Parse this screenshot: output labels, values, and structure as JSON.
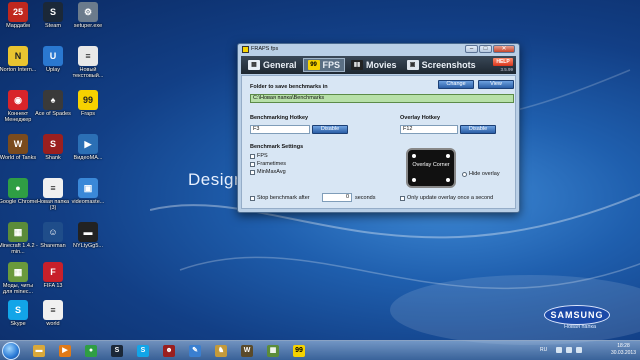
{
  "desktop": {
    "wallpaper_text": "Design",
    "brand": {
      "logo": "SAMSUNG",
      "subtitle": "Новая папка"
    },
    "icons": [
      {
        "label": "Мардабм",
        "color": "#c0281e",
        "glyph": "25"
      },
      {
        "label": "Steam",
        "color": "#1b2838",
        "glyph": "S"
      },
      {
        "label": "setuper.exe",
        "color": "#6b7b8c",
        "glyph": "⚙"
      },
      {
        "label": "Norton Intern...",
        "color": "#e9c430",
        "glyph": "N"
      },
      {
        "label": "Uplay",
        "color": "#2a78d0",
        "glyph": "U"
      },
      {
        "label": "Новый текстовый...",
        "color": "#e8e8e8",
        "glyph": "≡"
      },
      {
        "label": "Коннект Менеджер",
        "color": "#d8242a",
        "glyph": "◉"
      },
      {
        "label": "Ace of Spades",
        "color": "#3a3a3a",
        "glyph": "♠"
      },
      {
        "label": "Fraps",
        "color": "#f6d200",
        "glyph": "99"
      },
      {
        "label": "World of Tanks",
        "color": "#7a4b1e",
        "glyph": "W"
      },
      {
        "label": "Shank",
        "color": "#9a1f1f",
        "glyph": "S"
      },
      {
        "label": "ВидеоМА...",
        "color": "#2b6fb5",
        "glyph": "▶"
      },
      {
        "label": "Google Chrome",
        "color": "#2f9e44",
        "glyph": "●"
      },
      {
        "label": "Новая папка (3)",
        "color": "#f0f0f0",
        "glyph": "≡"
      },
      {
        "label": "videomaste...",
        "color": "#3a88d8",
        "glyph": "▣"
      },
      {
        "label": "Minecraft 1.4.2 - min...",
        "color": "#5b8c3a",
        "glyph": "▦"
      },
      {
        "label": "Shareman",
        "color": "#1f4d8a",
        "glyph": "☺"
      },
      {
        "label": "NYLtyGg5...",
        "color": "#222222",
        "glyph": "▬"
      },
      {
        "label": "Моды, читы для minec...",
        "color": "#6a9a3c",
        "glyph": "▦"
      },
      {
        "label": "FIFA 13",
        "color": "#c8202a",
        "glyph": "F"
      },
      {
        "label": "Skype",
        "color": "#12a5e8",
        "glyph": "S"
      },
      {
        "label": "world",
        "color": "#f0f0f0",
        "glyph": "≡"
      }
    ]
  },
  "window": {
    "title": "FRAPS fps",
    "controls": {
      "minimize": "–",
      "maximize": "□",
      "close": "✕"
    },
    "tabs": [
      {
        "label": "General",
        "icon": "grid-icon",
        "glyph": "▦"
      },
      {
        "label": "FPS",
        "icon": "fraps-99-icon",
        "glyph": "99"
      },
      {
        "label": "Movies",
        "icon": "film-icon",
        "glyph": "▮▮"
      },
      {
        "label": "Screenshots",
        "icon": "camera-icon",
        "glyph": "▣"
      }
    ],
    "active_tab": "FPS",
    "help_label": "HELP",
    "version": "3.5.99",
    "fps": {
      "folder_label": "Folder to save benchmarks in",
      "change_label": "Change",
      "view_label": "View",
      "folder_path": "C:\\Новая папка\\Benchmarks",
      "bench_hotkey_label": "Benchmarking Hotkey",
      "bench_hotkey_value": "F3",
      "bench_disable_label": "Disable",
      "overlay_hotkey_label": "Overlay Hotkey",
      "overlay_hotkey_value": "F12",
      "overlay_disable_label": "Disable",
      "settings_label": "Benchmark Settings",
      "settings": [
        "FPS",
        "Frametimes",
        "MinMaxAvg"
      ],
      "overlay_corner_label": "Overlay Corner",
      "hide_overlay_label": "Hide overlay",
      "stop_after_label": "Stop benchmark after",
      "stop_after_value": "0",
      "seconds_label": "seconds",
      "update_once_label": "Only update overlay once a second"
    }
  },
  "taskbar": {
    "items": [
      {
        "name": "explorer",
        "color": "#d9a83a",
        "glyph": "▬"
      },
      {
        "name": "media-player",
        "color": "#e07a18",
        "glyph": "▶"
      },
      {
        "name": "chrome",
        "color": "#2f9e44",
        "glyph": "●"
      },
      {
        "name": "steam",
        "color": "#1b2838",
        "glyph": "S"
      },
      {
        "name": "skype",
        "color": "#12a5e8",
        "glyph": "S"
      },
      {
        "name": "shank",
        "color": "#9a1f1f",
        "glyph": "☻"
      },
      {
        "name": "paint",
        "color": "#3a7fd0",
        "glyph": "✎"
      },
      {
        "name": "chess",
        "color": "#c49a3a",
        "glyph": "♞"
      },
      {
        "name": "world-of-tanks",
        "color": "#5a4a2a",
        "glyph": "W"
      },
      {
        "name": "minecraft",
        "color": "#5b8c3a",
        "glyph": "▦"
      },
      {
        "name": "fraps",
        "color": "#f6d200",
        "glyph": "99"
      }
    ],
    "language": "RU",
    "time": "18:28",
    "date": "30.03.2013"
  }
}
